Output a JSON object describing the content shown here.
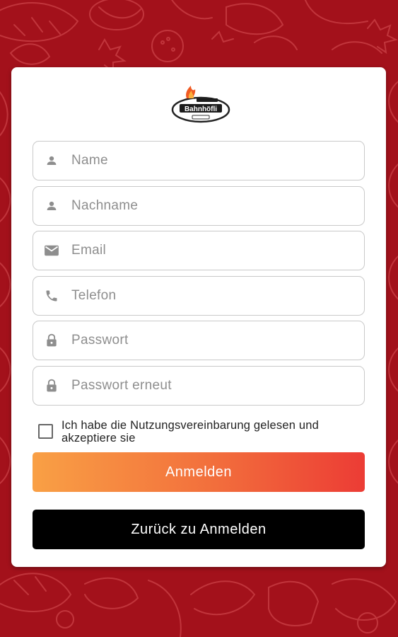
{
  "colors": {
    "background": "#a3111b",
    "card": "#ffffff",
    "primary_gradient_start": "#f9a045",
    "primary_gradient_end": "#ec3c35",
    "secondary_button": "#000000"
  },
  "logo": {
    "brand_text": "Bahnhöfli",
    "icon": "flame-logo"
  },
  "form": {
    "fields": [
      {
        "icon": "person-icon",
        "placeholder": "Name",
        "value": ""
      },
      {
        "icon": "person-icon",
        "placeholder": "Nachname",
        "value": ""
      },
      {
        "icon": "email-icon",
        "placeholder": "Email",
        "value": ""
      },
      {
        "icon": "phone-icon",
        "placeholder": "Telefon",
        "value": ""
      },
      {
        "icon": "lock-icon",
        "placeholder": "Passwort",
        "value": ""
      },
      {
        "icon": "lock-icon",
        "placeholder": "Passwort erneut",
        "value": ""
      }
    ],
    "terms_label": "Ich habe die Nutzungsvereinbarung gelesen und akzeptiere sie",
    "terms_checked": false,
    "submit_label": "Anmelden",
    "back_label": "Zurück zu Anmelden"
  }
}
